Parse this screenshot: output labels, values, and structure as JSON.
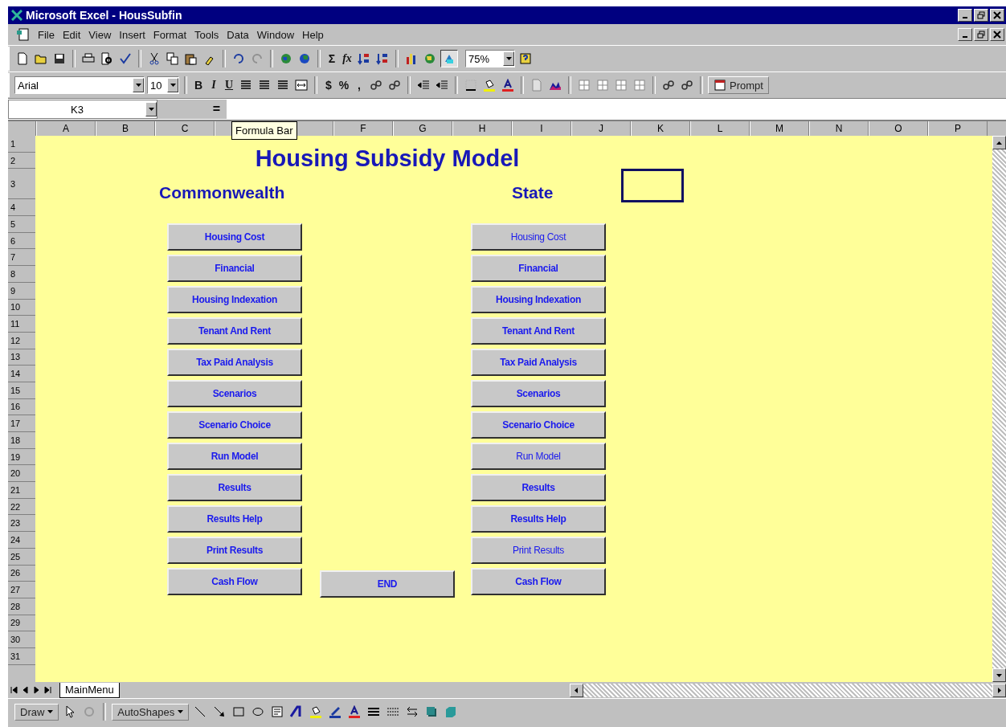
{
  "window": {
    "title": "Microsoft Excel - HousSubfin"
  },
  "menu": [
    "File",
    "Edit",
    "View",
    "Insert",
    "Format",
    "Tools",
    "Data",
    "Window",
    "Help"
  ],
  "standard_toolbar": {
    "autosum": "Σ",
    "function": "fx",
    "zoom": "75%"
  },
  "formatting_toolbar": {
    "font": "Arial",
    "size": "10",
    "styles": [
      "B",
      "I",
      "U"
    ],
    "number_formats": [
      "$",
      "%",
      ","
    ],
    "prompt": "Prompt"
  },
  "formula_bar": {
    "name_box": "K3",
    "equals": "=",
    "tooltip": "Formula Bar"
  },
  "columns": [
    "A",
    "B",
    "C",
    null,
    null,
    "F",
    "G",
    "H",
    "I",
    "J",
    "K",
    "L",
    "M",
    "N",
    "O",
    "P"
  ],
  "rows": [
    "1",
    "2",
    "3",
    "4",
    "5",
    "6",
    "7",
    "8",
    "9",
    "10",
    "11",
    "12",
    "13",
    "14",
    "15",
    "16",
    "17",
    "18",
    "19",
    "20",
    "21",
    "22",
    "23",
    "24",
    "25",
    "26",
    "27",
    "28",
    "29",
    "30",
    "31"
  ],
  "sheet": {
    "title": "Housing Subsidy Model",
    "sections": [
      {
        "heading": "Commonwealth",
        "buttons": [
          {
            "label": "Housing Cost",
            "bold": true
          },
          {
            "label": "Financial",
            "bold": true
          },
          {
            "label": "Housing Indexation",
            "bold": true
          },
          {
            "label": "Tenant And Rent",
            "bold": true
          },
          {
            "label": "Tax Paid Analysis",
            "bold": true
          },
          {
            "label": "Scenarios",
            "bold": true
          },
          {
            "label": "Scenario Choice",
            "bold": true
          },
          {
            "label": "Run Model",
            "bold": true
          },
          {
            "label": "Results",
            "bold": true
          },
          {
            "label": "Results Help",
            "bold": true
          },
          {
            "label": "Print Results",
            "bold": true
          },
          {
            "label": "Cash Flow",
            "bold": true
          }
        ]
      },
      {
        "heading": "State",
        "buttons": [
          {
            "label": "Housing Cost",
            "bold": false
          },
          {
            "label": "Financial",
            "bold": true
          },
          {
            "label": "Housing Indexation",
            "bold": true
          },
          {
            "label": "Tenant And Rent",
            "bold": true
          },
          {
            "label": "Tax Paid Analysis",
            "bold": true
          },
          {
            "label": "Scenarios",
            "bold": true
          },
          {
            "label": "Scenario Choice",
            "bold": true
          },
          {
            "label": "Run Model",
            "bold": false
          },
          {
            "label": "Results",
            "bold": true
          },
          {
            "label": "Results Help",
            "bold": true
          },
          {
            "label": "Print Results",
            "bold": false
          },
          {
            "label": "Cash Flow",
            "bold": true
          }
        ]
      }
    ],
    "end_button": {
      "label": "END",
      "bold": true
    }
  },
  "sheet_tabs": [
    {
      "label": "MainMenu",
      "selected": true
    }
  ],
  "drawing_toolbar": {
    "draw": "Draw",
    "autoshapes": "AutoShapes"
  }
}
